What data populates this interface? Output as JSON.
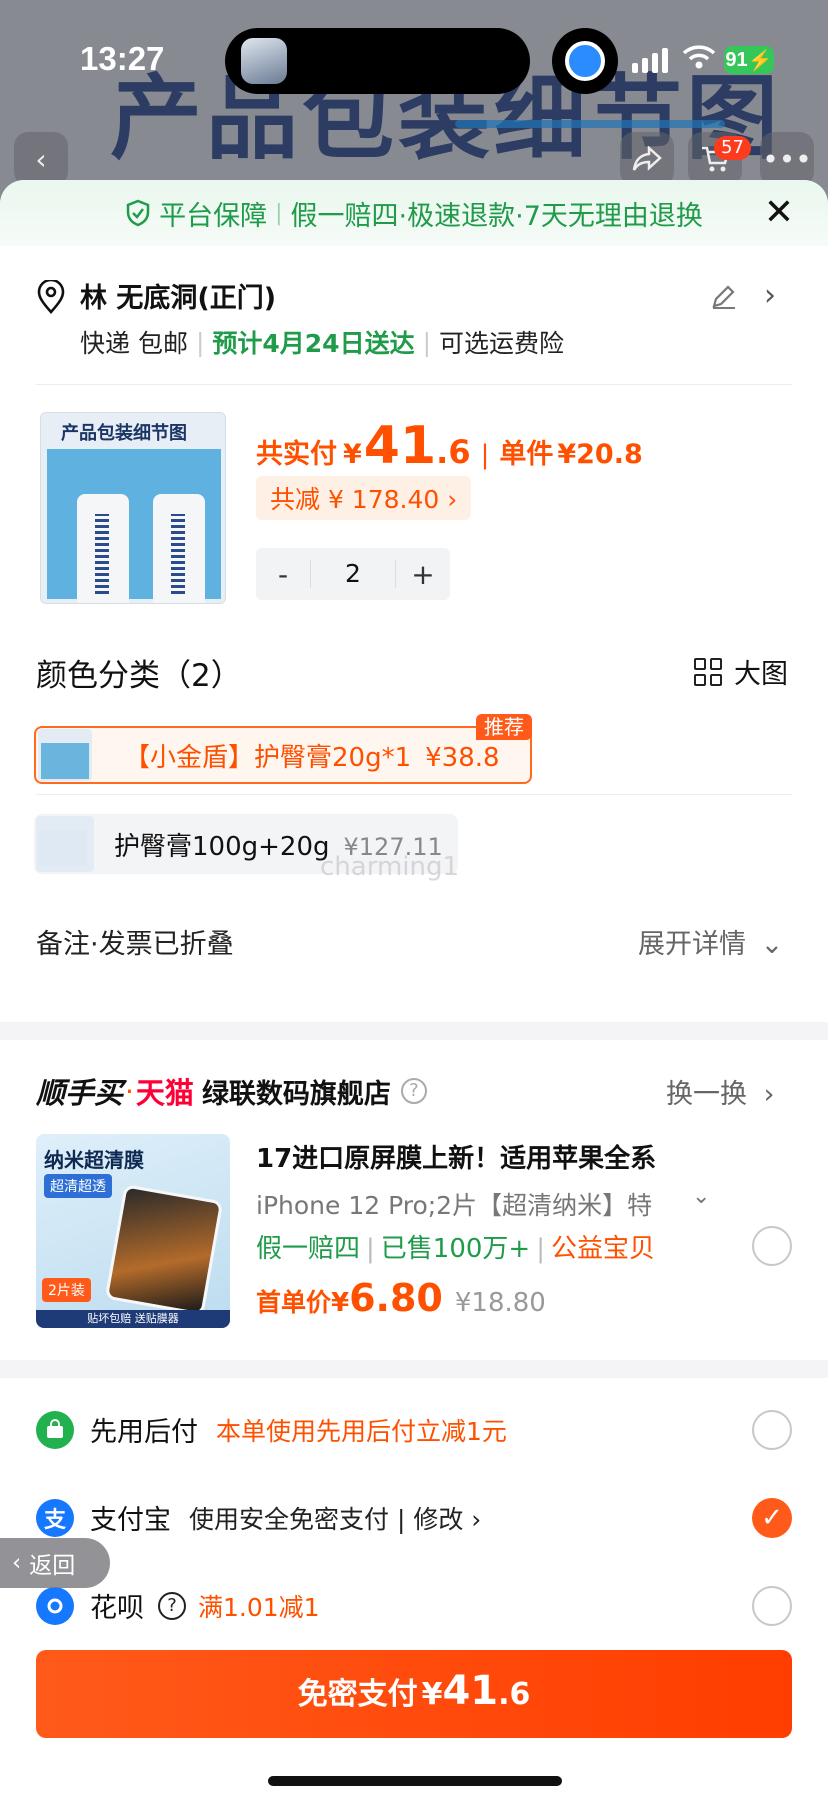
{
  "status_bar": {
    "time": "13:27",
    "battery": "91"
  },
  "background": {
    "title": "产品包装细节图",
    "cart_count": "57",
    "back_icon": "chevron-left",
    "share_icon": "share",
    "cart_icon": "cart",
    "more_icon": "more-dots"
  },
  "guarantee": {
    "label": "平台保障",
    "items": [
      "假一赔四",
      "极速退款",
      "7天无理由退换"
    ],
    "text": "假一赔四·极速退款·7天无理由退换",
    "color": "#1f9b4a"
  },
  "address": {
    "name": "林 无底洞(正门)",
    "shipping": "快递 包邮",
    "delivery": "预计4月24日送达",
    "insurance": "可选运费险"
  },
  "product": {
    "image_label": "产品包装细节图",
    "total_label": "共实付",
    "currency": "¥",
    "total_int": "41",
    "total_dec": ".6",
    "unit_label": "单件",
    "unit_price": "¥20.8",
    "discount": "共减 ¥ 178.40 ›",
    "quantity": "2",
    "minus": "-",
    "plus": "+"
  },
  "variants": {
    "title": "颜色分类（2）",
    "big_image": "大图",
    "options": [
      {
        "name": "【小金盾】护臀膏20g*1",
        "price": "¥38.8",
        "selected": true,
        "tag": "推荐"
      },
      {
        "name": "护臀膏100g+20g",
        "price": "¥127.11",
        "selected": false
      }
    ],
    "watermark": "charming1"
  },
  "notes": {
    "label": "备注·发票已折叠",
    "expand": "展开详情"
  },
  "recommend": {
    "brand1": "顺手买",
    "brand2": "天猫",
    "shop": "绿联数码旗舰店",
    "swap": "换一换",
    "image_title": "纳米超清膜",
    "image_badge": "超清超透",
    "image_pack": "2片装",
    "image_foot": "贴坏包赔 送贴膜器",
    "title": "17进口原屏膜上新！适用苹果全系",
    "spec": "iPhone 12 Pro;2片【超清纳米】特",
    "tag1": "假一赔四",
    "tag2": "已售100万+",
    "tag3": "公益宝贝",
    "price_label": "首单价",
    "currency": "¥",
    "price": "6.80",
    "orig_price": "¥18.80"
  },
  "payments": [
    {
      "name": "先用后付",
      "desc": "本单使用先用后付立减1元",
      "checked": false,
      "color": "#21b14f"
    },
    {
      "name": "支付宝",
      "desc": "使用安全免密支付 | 修改 ›",
      "checked": true,
      "color": "#1677ff"
    },
    {
      "name": "花呗",
      "desc": "满1.01减1",
      "checked": false,
      "color": "#1677ff"
    }
  ],
  "back_pill": "返回",
  "pay_button": {
    "label": "免密支付",
    "currency": "¥",
    "int": "41",
    "dec": ".6"
  },
  "colors": {
    "accent": "#ff5000",
    "green": "#1f9b4a",
    "tmall_red": "#ff0036"
  }
}
